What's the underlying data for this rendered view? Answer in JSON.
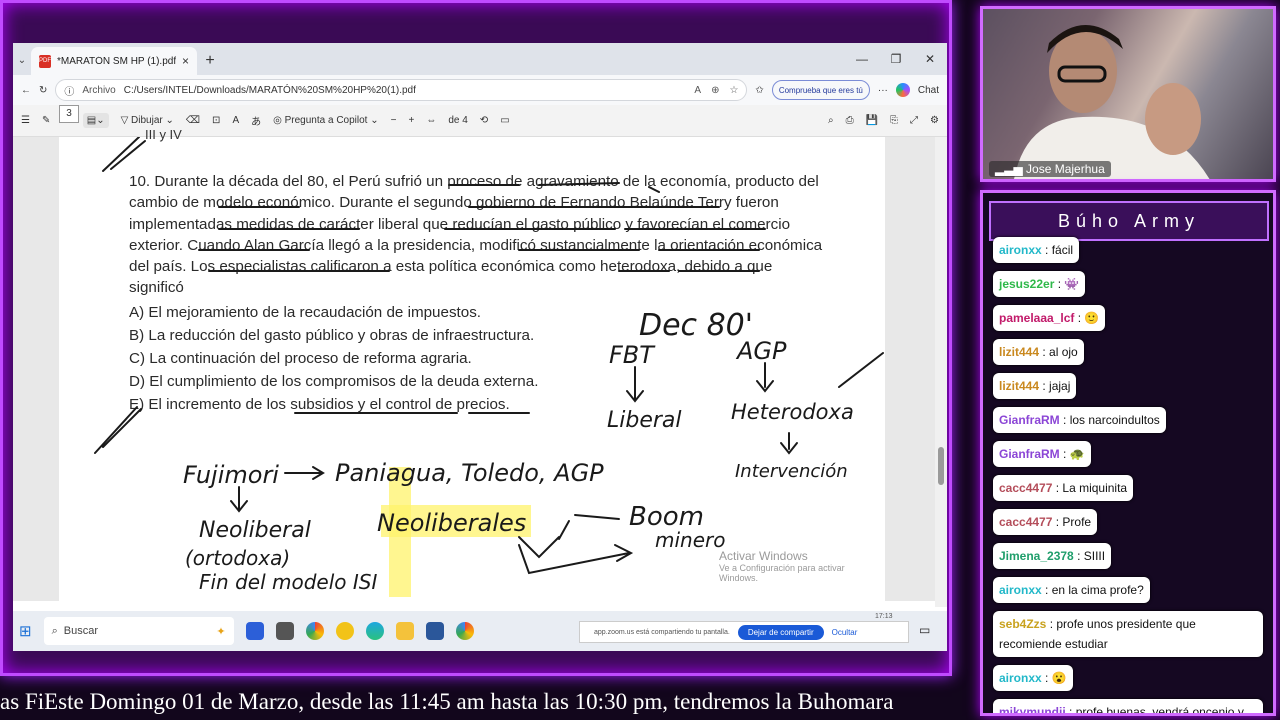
{
  "browser": {
    "tab_title": "*MARATÓN SM HP (1).pdf",
    "address_label": "Archivo",
    "url": "C:/Users/INTEL/Downloads/MARATÓN%20SM%20HP%20(1).pdf",
    "profile_pill": "Comprueba que eres tú",
    "chat_label": "Chat"
  },
  "pdf_toolbar": {
    "draw_label": "Dibujar",
    "copilot_label": "Pregunta a Copilot",
    "page_current": "3",
    "page_total": "de 4"
  },
  "document": {
    "question": "10. Durante la década del 80, el Perú sufrió un proceso de agravamiento de la economía, producto del cambio de modelo económico. Durante el segundo gobierno de Fernando Belaúnde Terry fueron implementadas medidas de carácter liberal que reducían el gasto público y favorecían el comercio exterior. Cuando Alan García llegó a la presidencia, modificó sustancialmente la orientación económica del país. Los especialistas calificaron a esta política económica como heterodoxa, debido a que significó",
    "options": [
      "A) El mejoramiento de la recaudación de impuestos.",
      "B) La reducción del gasto público y obras de infraestructura.",
      "C) La continuación del proceso de reforma agraria.",
      "D) El cumplimiento de los compromisos de la deuda externa.",
      "E) El incremento de los subsidios y el control de precios."
    ],
    "top_fragment": "III y IV",
    "handwriting": {
      "dec": "Dec 80'",
      "fbt": "FBT",
      "liberal": "Liberal",
      "agp": "AGP",
      "heterodoxa": "Heterodoxa",
      "intervencion": "Intervención",
      "fujimori": "Fujimori",
      "paniagua": "Paniagua, Toledo, AGP",
      "neoliberal": "Neoliberal",
      "ortodoxa": "(ortodoxa)",
      "fin": "Fin del modelo ISI",
      "neoliberales": "Neoliberales",
      "boom": "Boom",
      "minero": "minero"
    },
    "watermark_title": "Activar Windows",
    "watermark_sub": "Ve a Configuración para activar Windows."
  },
  "taskbar": {
    "search_label": "Buscar",
    "share_notice": "app.zoom.us está compartiendo tu pantalla.",
    "stop_share": "Dejar de compartir",
    "hide": "Ocultar",
    "time": "17:13"
  },
  "ticker": "as FiEste Domingo 01 de Marzo, desde las 11:45 am hasta las 10:30 pm, tendremos la Buhomara",
  "webcam": {
    "name": "Jose Majerhua"
  },
  "chat": {
    "title": "Búho Army",
    "messages": [
      {
        "user": "aironxx",
        "text": ": fácil",
        "color": "#22b8c9"
      },
      {
        "user": "jesus22er",
        "text": ": 👾",
        "color": "#2fb84a"
      },
      {
        "user": "pamelaaa_lcf",
        "text": ": 🙂",
        "color": "#c21a6a"
      },
      {
        "user": "lizit444",
        "text": ": al ojo",
        "color": "#c9881e"
      },
      {
        "user": "lizit444",
        "text": ": jajaj",
        "color": "#c9881e"
      },
      {
        "user": "GianfraRM",
        "text": ": los narcoindultos",
        "color": "#8b45d6"
      },
      {
        "user": "GianfraRM",
        "text": ": 🐢",
        "color": "#8b45d6"
      },
      {
        "user": "cacc4477",
        "text": ": La miquinita",
        "color": "#b44d5a"
      },
      {
        "user": "cacc4477",
        "text": ": Profe",
        "color": "#b44d5a"
      },
      {
        "user": "Jimena_2378",
        "text": ": SIIII",
        "color": "#1f9e6b"
      },
      {
        "user": "aironxx",
        "text": ": en la cima profe?",
        "color": "#22b8c9"
      },
      {
        "user": "seb4Zzs",
        "text": ": profe unos presidente que recomiende estudiar",
        "color": "#c9a21e"
      },
      {
        "user": "aironxx",
        "text": ": 😮",
        "color": "#22b8c9"
      },
      {
        "user": "mikymundii",
        "text": ": profe buenas, vendrá oncenio y ochenio para este proceso?",
        "color": "#8b45d6"
      }
    ]
  }
}
